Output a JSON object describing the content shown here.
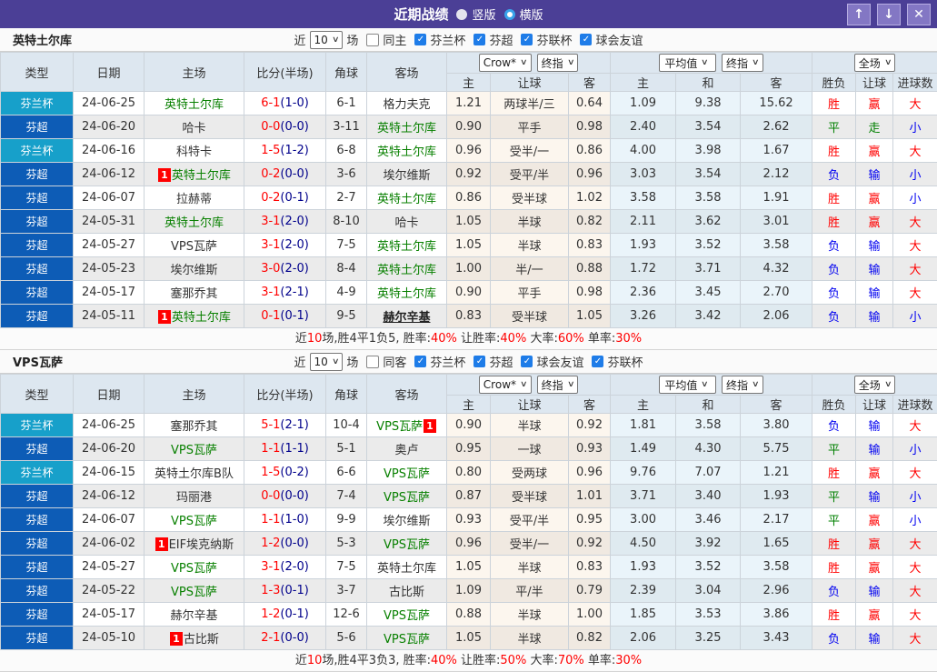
{
  "badge_char": "1",
  "colors": {
    "titlebar_purple": "#4b3f96",
    "cup_cyan": "#17a0ca",
    "super_blue": "#0d5cb6",
    "win_red": "#ff0000",
    "draw_green": "#008000",
    "lose_blue": "#0000f0",
    "tracked_team_green": "#088000"
  },
  "titlebar": {
    "title": "近期战绩",
    "radio_vertical": "竖版",
    "radio_horizontal": "横版",
    "up_icon": "↑",
    "down_icon": "↓",
    "close_icon": "✕"
  },
  "header_labels": {
    "type": "类型",
    "date": "日期",
    "home": "主场",
    "score": "比分(半场)",
    "corner": "角球",
    "away": "客场",
    "selects": {
      "crow": "Crow*",
      "final1": "终指",
      "avg": "平均值",
      "final2": "终指",
      "full": "全场"
    },
    "sub": [
      "主",
      "让球",
      "客",
      "主",
      "和",
      "客",
      "胜负",
      "让球",
      "进球数"
    ]
  },
  "tables": [
    {
      "team": "英特土尔库",
      "filter": {
        "near": "近",
        "count": "10",
        "matches": "场",
        "same": "同主",
        "leagues": [
          "芬兰杯",
          "芬超",
          "芬联杯",
          "球会友谊"
        ]
      },
      "rows": [
        {
          "lg": "芬兰杯",
          "lgc": "cup",
          "date": "24-06-25",
          "home": {
            "n": "英特土尔库",
            "g": 1
          },
          "score": "6-1",
          "half": "(1-0)",
          "corner": "6-1",
          "away": {
            "n": "格力夫克"
          },
          "odds": [
            "1.21",
            "两球半/三",
            "0.64"
          ],
          "avg": [
            "1.09",
            "9.38",
            "15.62"
          ],
          "res": [
            [
              "胜",
              "r"
            ],
            [
              "赢",
              "r"
            ],
            [
              "大",
              "r"
            ]
          ]
        },
        {
          "lg": "芬超",
          "lgc": "sup",
          "date": "24-06-20",
          "home": {
            "n": "哈卡"
          },
          "score": "0-0",
          "half": "(0-0)",
          "corner": "3-11",
          "away": {
            "n": "英特土尔库",
            "g": 1
          },
          "odds": [
            "0.90",
            "平手",
            "0.98"
          ],
          "avg": [
            "2.40",
            "3.54",
            "2.62"
          ],
          "res": [
            [
              "平",
              "g"
            ],
            [
              "走",
              "g"
            ],
            [
              "小",
              "b"
            ]
          ]
        },
        {
          "lg": "芬兰杯",
          "lgc": "cup",
          "date": "24-06-16",
          "home": {
            "n": "科特卡"
          },
          "score": "1-5",
          "half": "(1-2)",
          "corner": "6-8",
          "away": {
            "n": "英特土尔库",
            "g": 1
          },
          "odds": [
            "0.96",
            "受半/一",
            "0.86"
          ],
          "avg": [
            "4.00",
            "3.98",
            "1.67"
          ],
          "res": [
            [
              "胜",
              "r"
            ],
            [
              "赢",
              "r"
            ],
            [
              "大",
              "r"
            ]
          ]
        },
        {
          "lg": "芬超",
          "lgc": "sup",
          "date": "24-06-12",
          "home": {
            "n": "英特土尔库",
            "g": 1,
            "bp": 1
          },
          "score": "0-2",
          "half": "(0-0)",
          "corner": "3-6",
          "away": {
            "n": "埃尔维斯"
          },
          "odds": [
            "0.92",
            "受平/半",
            "0.96"
          ],
          "avg": [
            "3.03",
            "3.54",
            "2.12"
          ],
          "res": [
            [
              "负",
              "b"
            ],
            [
              "输",
              "b"
            ],
            [
              "小",
              "b"
            ]
          ]
        },
        {
          "lg": "芬超",
          "lgc": "sup",
          "date": "24-06-07",
          "home": {
            "n": "拉赫蒂"
          },
          "score": "0-2",
          "half": "(0-1)",
          "corner": "2-7",
          "away": {
            "n": "英特土尔库",
            "g": 1
          },
          "odds": [
            "0.86",
            "受半球",
            "1.02"
          ],
          "avg": [
            "3.58",
            "3.58",
            "1.91"
          ],
          "res": [
            [
              "胜",
              "r"
            ],
            [
              "赢",
              "r"
            ],
            [
              "小",
              "b"
            ]
          ]
        },
        {
          "lg": "芬超",
          "lgc": "sup",
          "date": "24-05-31",
          "home": {
            "n": "英特土尔库",
            "g": 1
          },
          "score": "3-1",
          "half": "(2-0)",
          "corner": "8-10",
          "away": {
            "n": "哈卡"
          },
          "odds": [
            "1.05",
            "半球",
            "0.82"
          ],
          "avg": [
            "2.11",
            "3.62",
            "3.01"
          ],
          "res": [
            [
              "胜",
              "r"
            ],
            [
              "赢",
              "r"
            ],
            [
              "大",
              "r"
            ]
          ]
        },
        {
          "lg": "芬超",
          "lgc": "sup",
          "date": "24-05-27",
          "home": {
            "n": "VPS瓦萨"
          },
          "score": "3-1",
          "half": "(2-0)",
          "corner": "7-5",
          "away": {
            "n": "英特土尔库",
            "g": 1
          },
          "odds": [
            "1.05",
            "半球",
            "0.83"
          ],
          "avg": [
            "1.93",
            "3.52",
            "3.58"
          ],
          "res": [
            [
              "负",
              "b"
            ],
            [
              "输",
              "b"
            ],
            [
              "大",
              "r"
            ]
          ]
        },
        {
          "lg": "芬超",
          "lgc": "sup",
          "date": "24-05-23",
          "home": {
            "n": "埃尔维斯"
          },
          "score": "3-0",
          "half": "(2-0)",
          "corner": "8-4",
          "away": {
            "n": "英特土尔库",
            "g": 1
          },
          "odds": [
            "1.00",
            "半/一",
            "0.88"
          ],
          "avg": [
            "1.72",
            "3.71",
            "4.32"
          ],
          "res": [
            [
              "负",
              "b"
            ],
            [
              "输",
              "b"
            ],
            [
              "大",
              "r"
            ]
          ]
        },
        {
          "lg": "芬超",
          "lgc": "sup",
          "date": "24-05-17",
          "home": {
            "n": "塞那乔其"
          },
          "score": "3-1",
          "half": "(2-1)",
          "corner": "4-9",
          "away": {
            "n": "英特土尔库",
            "g": 1
          },
          "odds": [
            "0.90",
            "平手",
            "0.98"
          ],
          "avg": [
            "2.36",
            "3.45",
            "2.70"
          ],
          "res": [
            [
              "负",
              "b"
            ],
            [
              "输",
              "b"
            ],
            [
              "大",
              "r"
            ]
          ]
        },
        {
          "lg": "芬超",
          "lgc": "sup",
          "date": "24-05-11",
          "home": {
            "n": "英特土尔库",
            "g": 1,
            "bp": 1
          },
          "score": "0-1",
          "half": "(0-1)",
          "corner": "9-5",
          "away": {
            "n": "赫尔辛基",
            "u": 1
          },
          "odds": [
            "0.83",
            "受半球",
            "1.05"
          ],
          "avg": [
            "3.26",
            "3.42",
            "2.06"
          ],
          "res": [
            [
              "负",
              "b"
            ],
            [
              "输",
              "b"
            ],
            [
              "小",
              "b"
            ]
          ]
        }
      ],
      "summary": [
        [
          "近",
          0
        ],
        [
          "10",
          1
        ],
        [
          "场,胜4平1负5, 胜率:",
          0
        ],
        [
          "40%",
          1
        ],
        [
          " 让胜率:",
          0
        ],
        [
          "40%",
          1
        ],
        [
          " 大率:",
          0
        ],
        [
          "60%",
          1
        ],
        [
          " 单率:",
          0
        ],
        [
          "30%",
          1
        ]
      ]
    },
    {
      "team": "VPS瓦萨",
      "filter": {
        "near": "近",
        "count": "10",
        "matches": "场",
        "same": "同客",
        "leagues": [
          "芬兰杯",
          "芬超",
          "球会友谊",
          "芬联杯"
        ]
      },
      "rows": [
        {
          "lg": "芬兰杯",
          "lgc": "cup",
          "date": "24-06-25",
          "home": {
            "n": "塞那乔其"
          },
          "score": "5-1",
          "half": "(2-1)",
          "corner": "10-4",
          "away": {
            "n": "VPS瓦萨",
            "g": 1,
            "ba": 1
          },
          "odds": [
            "0.90",
            "半球",
            "0.92"
          ],
          "avg": [
            "1.81",
            "3.58",
            "3.80"
          ],
          "res": [
            [
              "负",
              "b"
            ],
            [
              "输",
              "b"
            ],
            [
              "大",
              "r"
            ]
          ]
        },
        {
          "lg": "芬超",
          "lgc": "sup",
          "date": "24-06-20",
          "home": {
            "n": "VPS瓦萨",
            "g": 1
          },
          "score": "1-1",
          "half": "(1-1)",
          "corner": "5-1",
          "away": {
            "n": "奥卢"
          },
          "odds": [
            "0.95",
            "一球",
            "0.93"
          ],
          "avg": [
            "1.49",
            "4.30",
            "5.75"
          ],
          "res": [
            [
              "平",
              "g"
            ],
            [
              "输",
              "b"
            ],
            [
              "小",
              "b"
            ]
          ]
        },
        {
          "lg": "芬兰杯",
          "lgc": "cup",
          "date": "24-06-15",
          "home": {
            "n": "英特土尔库B队"
          },
          "score": "1-5",
          "half": "(0-2)",
          "corner": "6-6",
          "away": {
            "n": "VPS瓦萨",
            "g": 1
          },
          "odds": [
            "0.80",
            "受两球",
            "0.96"
          ],
          "avg": [
            "9.76",
            "7.07",
            "1.21"
          ],
          "res": [
            [
              "胜",
              "r"
            ],
            [
              "赢",
              "r"
            ],
            [
              "大",
              "r"
            ]
          ]
        },
        {
          "lg": "芬超",
          "lgc": "sup",
          "date": "24-06-12",
          "home": {
            "n": "玛丽港"
          },
          "score": "0-0",
          "half": "(0-0)",
          "corner": "7-4",
          "away": {
            "n": "VPS瓦萨",
            "g": 1
          },
          "odds": [
            "0.87",
            "受半球",
            "1.01"
          ],
          "avg": [
            "3.71",
            "3.40",
            "1.93"
          ],
          "res": [
            [
              "平",
              "g"
            ],
            [
              "输",
              "b"
            ],
            [
              "小",
              "b"
            ]
          ]
        },
        {
          "lg": "芬超",
          "lgc": "sup",
          "date": "24-06-07",
          "home": {
            "n": "VPS瓦萨",
            "g": 1
          },
          "score": "1-1",
          "half": "(1-0)",
          "corner": "9-9",
          "away": {
            "n": "埃尔维斯"
          },
          "odds": [
            "0.93",
            "受平/半",
            "0.95"
          ],
          "avg": [
            "3.00",
            "3.46",
            "2.17"
          ],
          "res": [
            [
              "平",
              "g"
            ],
            [
              "赢",
              "r"
            ],
            [
              "小",
              "b"
            ]
          ]
        },
        {
          "lg": "芬超",
          "lgc": "sup",
          "date": "24-06-02",
          "home": {
            "n": "EIF埃克纳斯",
            "bp": 1
          },
          "score": "1-2",
          "half": "(0-0)",
          "corner": "5-3",
          "away": {
            "n": "VPS瓦萨",
            "g": 1
          },
          "odds": [
            "0.96",
            "受半/一",
            "0.92"
          ],
          "avg": [
            "4.50",
            "3.92",
            "1.65"
          ],
          "res": [
            [
              "胜",
              "r"
            ],
            [
              "赢",
              "r"
            ],
            [
              "大",
              "r"
            ]
          ]
        },
        {
          "lg": "芬超",
          "lgc": "sup",
          "date": "24-05-27",
          "home": {
            "n": "VPS瓦萨",
            "g": 1
          },
          "score": "3-1",
          "half": "(2-0)",
          "corner": "7-5",
          "away": {
            "n": "英特土尔库"
          },
          "odds": [
            "1.05",
            "半球",
            "0.83"
          ],
          "avg": [
            "1.93",
            "3.52",
            "3.58"
          ],
          "res": [
            [
              "胜",
              "r"
            ],
            [
              "赢",
              "r"
            ],
            [
              "大",
              "r"
            ]
          ]
        },
        {
          "lg": "芬超",
          "lgc": "sup",
          "date": "24-05-22",
          "home": {
            "n": "VPS瓦萨",
            "g": 1
          },
          "score": "1-3",
          "half": "(0-1)",
          "corner": "3-7",
          "away": {
            "n": "古比斯"
          },
          "odds": [
            "1.09",
            "平/半",
            "0.79"
          ],
          "avg": [
            "2.39",
            "3.04",
            "2.96"
          ],
          "res": [
            [
              "负",
              "b"
            ],
            [
              "输",
              "b"
            ],
            [
              "大",
              "r"
            ]
          ]
        },
        {
          "lg": "芬超",
          "lgc": "sup",
          "date": "24-05-17",
          "home": {
            "n": "赫尔辛基"
          },
          "score": "1-2",
          "half": "(0-1)",
          "corner": "12-6",
          "away": {
            "n": "VPS瓦萨",
            "g": 1
          },
          "odds": [
            "0.88",
            "半球",
            "1.00"
          ],
          "avg": [
            "1.85",
            "3.53",
            "3.86"
          ],
          "res": [
            [
              "胜",
              "r"
            ],
            [
              "赢",
              "r"
            ],
            [
              "大",
              "r"
            ]
          ]
        },
        {
          "lg": "芬超",
          "lgc": "sup",
          "date": "24-05-10",
          "home": {
            "n": "古比斯",
            "bp": 1
          },
          "score": "2-1",
          "half": "(0-0)",
          "corner": "5-6",
          "away": {
            "n": "VPS瓦萨",
            "g": 1
          },
          "odds": [
            "1.05",
            "半球",
            "0.82"
          ],
          "avg": [
            "2.06",
            "3.25",
            "3.43"
          ],
          "res": [
            [
              "负",
              "b"
            ],
            [
              "输",
              "b"
            ],
            [
              "大",
              "r"
            ]
          ]
        }
      ],
      "summary": [
        [
          "近",
          0
        ],
        [
          "10",
          1
        ],
        [
          "场,胜4平3负3, 胜率:",
          0
        ],
        [
          "40%",
          1
        ],
        [
          " 让胜率:",
          0
        ],
        [
          "50%",
          1
        ],
        [
          " 大率:",
          0
        ],
        [
          "70%",
          1
        ],
        [
          " 单率:",
          0
        ],
        [
          "30%",
          1
        ]
      ]
    }
  ]
}
